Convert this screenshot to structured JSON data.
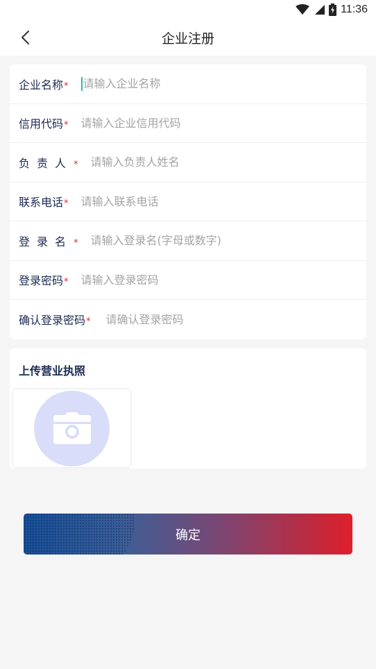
{
  "status_bar": {
    "time": "11:36",
    "icons": [
      "wifi-icon",
      "signal-icon",
      "battery-charging-icon"
    ]
  },
  "nav": {
    "back_icon": "chevron-left-icon",
    "title": "企业注册"
  },
  "form": {
    "fields": [
      {
        "label": "企业名称",
        "placeholder": "请输入企业名称",
        "value": "",
        "required": "*"
      },
      {
        "label": "信用代码",
        "placeholder": "请输入企业信用代码",
        "value": "",
        "required": "*"
      },
      {
        "label": "负责人",
        "placeholder": "请输入负责人姓名",
        "value": "",
        "required": "*"
      },
      {
        "label": "联系电话",
        "placeholder": "请输入联系电话",
        "value": "",
        "required": "*"
      },
      {
        "label": "登录名",
        "placeholder": "请输入登录名(字母或数字)",
        "value": "",
        "required": "*"
      },
      {
        "label": "登录密码",
        "placeholder": "请输入登录密码",
        "value": "",
        "required": "*"
      },
      {
        "label": "确认登录密码",
        "placeholder": "请确认登录密码",
        "value": "",
        "required": "*"
      }
    ]
  },
  "upload": {
    "title": "上传营业执照",
    "icon": "camera-icon"
  },
  "confirm_button": {
    "label": "确定"
  },
  "colors": {
    "accent_cursor": "#2bb7c4",
    "label_text": "#1c2a52",
    "required_star": "#e02b2b",
    "button_gradient_start": "#164f95",
    "button_gradient_end": "#df1f2a",
    "upload_circle": "#d9ddfa"
  }
}
